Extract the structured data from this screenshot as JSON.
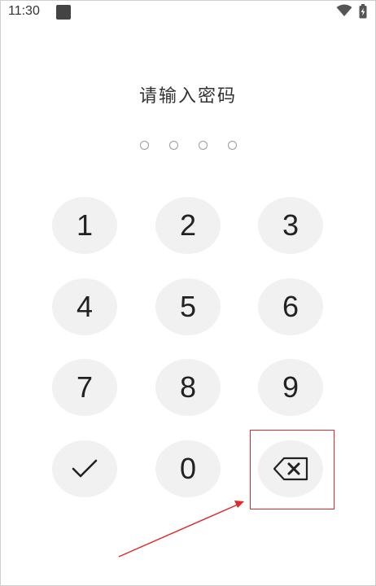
{
  "status_bar": {
    "time": "11:30",
    "icons": [
      "notification-square-icon",
      "wifi-icon",
      "battery-charging-icon"
    ]
  },
  "prompt": {
    "title": "请输入密码"
  },
  "pin": {
    "length": 4,
    "filled": 0
  },
  "keypad": {
    "keys": [
      "1",
      "2",
      "3",
      "4",
      "5",
      "6",
      "7",
      "8",
      "9"
    ],
    "zero": "0",
    "confirm_icon": "check-icon",
    "delete_icon": "backspace-icon"
  },
  "annotation": {
    "highlight_color": "#e0292a",
    "target": "delete-key"
  },
  "colors": {
    "key_background": "#f1f1f1",
    "text": "#222222",
    "dot_outline": "#9a9a9a"
  }
}
